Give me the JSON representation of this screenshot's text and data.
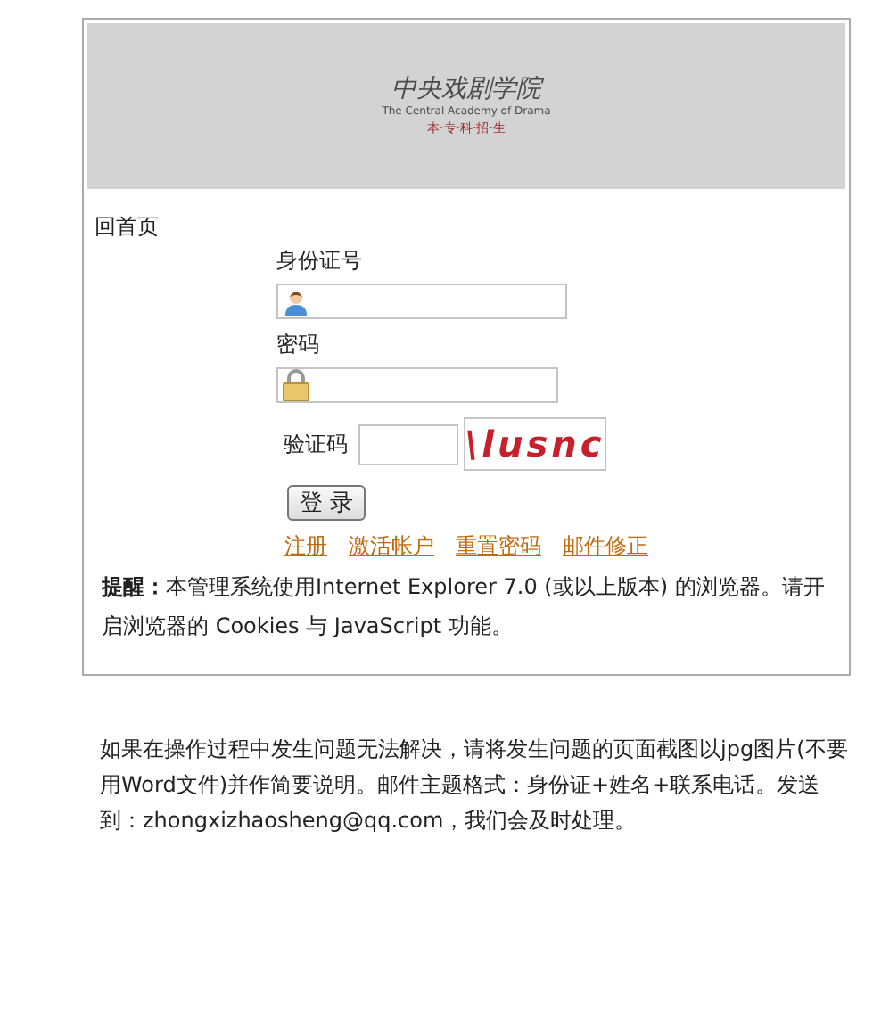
{
  "banner": {
    "logo_title": "中央戏剧学院",
    "logo_subtitle": "The Central Academy of Drama",
    "tagline": "本·专·科·招·生"
  },
  "home_link": "回首页",
  "fields": [
    {
      "label": "身份证号",
      "kind": "user"
    },
    {
      "label": "密码",
      "kind": "lock"
    }
  ],
  "captcha": {
    "label": "验证码",
    "code": "\\lusnc"
  },
  "login_button": "登 录",
  "links": [
    "注册",
    "激活帐户",
    "重置密码",
    "邮件修正"
  ],
  "notice": "**提醒：**本管理系统使用Internet Explorer 7.0 (或以上版本) 的浏览器。请开启浏览器的 Cookies 与 JavaScript 功能。",
  "help_text": "如果在操作过程中发生问题无法解决，请将发生问题的页面截图以jpg图片(不要用Word文件)并作简要说明。邮件主题格式：身份证+姓名+联系电话。发送到：zhongxizhaosheng@qq.com，我们会及时处理。"
}
